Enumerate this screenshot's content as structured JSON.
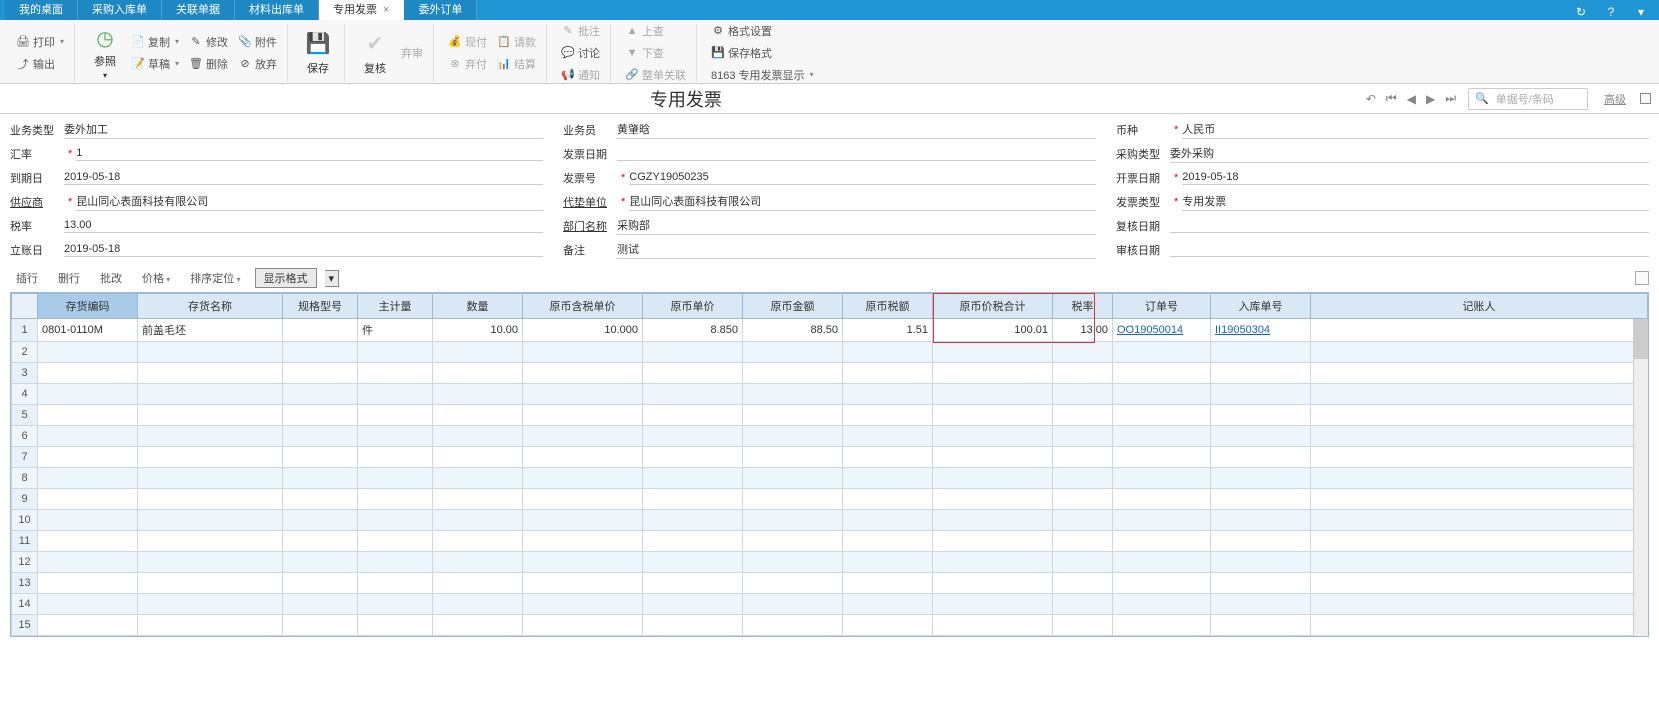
{
  "topTabs": {
    "items": [
      {
        "label": "我的桌面"
      },
      {
        "label": "采购入库单"
      },
      {
        "label": "关联单据"
      },
      {
        "label": "材料出库单"
      },
      {
        "label": "专用发票",
        "active": true,
        "close": true
      },
      {
        "label": "委外订单"
      }
    ]
  },
  "ribbon": {
    "print": "打印",
    "export": "输出",
    "ref": "参照",
    "copy": "复制",
    "mod": "修改",
    "draft": "草稿",
    "del": "删除",
    "attach": "附件",
    "discard": "放弃",
    "save": "保存",
    "recheck": "复核",
    "abandon": "弃审",
    "cash": "现付",
    "credit": "请款",
    "abandon2": "弃付",
    "settle": "结算",
    "approve": "批注",
    "discuss": "讨论",
    "notify": "通知",
    "up": "上查",
    "down": "下查",
    "alllink": "整单关联",
    "fmtset": "格式设置",
    "fmtsave": "保存格式",
    "show": "8163 专用发票显示"
  },
  "pageTitle": "专用发票",
  "nav": {
    "searchPlaceholder": "单据号/条码",
    "advanced": "高级"
  },
  "form": {
    "c1": {
      "bizTypeL": "业务类型",
      "bizType": "委外加工",
      "rateL": "汇率",
      "rate": "1",
      "dueL": "到期日",
      "due": "2019-05-18",
      "supplierL": "供应商",
      "supplier": "昆山同心表面科技有限公司",
      "taxL": "税率",
      "tax": "13.00",
      "postL": "立账日",
      "post": "2019-05-18"
    },
    "c2": {
      "salesL": "业务员",
      "sales": "黄肇晗",
      "invDateL": "发票日期",
      "invDate": "",
      "invNoL": "发票号",
      "invNo": "CGZY19050235",
      "padUnitL": "代垫单位",
      "padUnit": "昆山同心表面科技有限公司",
      "deptL": "部门名称",
      "dept": "采购部",
      "remarkL": "备注",
      "remark": "测试"
    },
    "c3": {
      "currL": "币种",
      "curr": "人民币",
      "buyTypeL": "采购类型",
      "buyType": "委外采购",
      "issueL": "开票日期",
      "issue": "2019-05-18",
      "invTypeL": "发票类型",
      "invType": "专用发票",
      "reviewL": "复核日期",
      "review": "",
      "auditL": "审核日期",
      "audit": ""
    }
  },
  "gridBar": {
    "insert": "插行",
    "delete": "删行",
    "batch": "批改",
    "price": "价格",
    "sort": "排序定位",
    "fmt": "显示格式"
  },
  "grid": {
    "headers": [
      "存货编码",
      "存货名称",
      "规格型号",
      "主计量",
      "数量",
      "原币含税单价",
      "原币单价",
      "原币金额",
      "原币税额",
      "原币价税合计",
      "税率",
      "订单号",
      "入库单号",
      "记账人"
    ],
    "row": {
      "code": "0801-0110M",
      "name": "前盖毛坯",
      "spec": "",
      "uom": "件",
      "qty": "10.00",
      "incTaxPrice": "10.000",
      "price": "8.850",
      "amt": "88.50",
      "taxAmt": "1.51",
      "total": "100.01",
      "taxRate": "13.00",
      "order": "OO19050014",
      "inbound": "II19050304",
      "booker": ""
    }
  }
}
